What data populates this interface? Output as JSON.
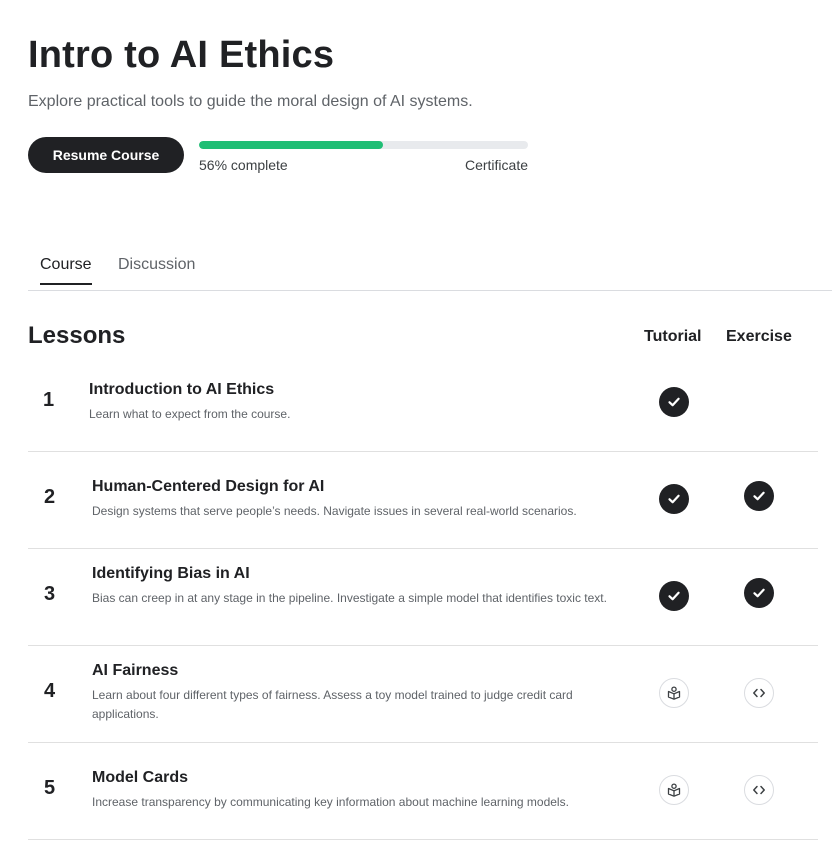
{
  "course": {
    "title": "Intro to AI Ethics",
    "subtitle": "Explore practical tools to guide the moral design of AI systems.",
    "resume_label": "Resume Course",
    "progress_percent": 56,
    "progress_text": "56% complete",
    "certificate_label": "Certificate"
  },
  "colors": {
    "progress": "#20be75",
    "primary": "#202124"
  },
  "tabs": [
    {
      "label": "Course",
      "active": true
    },
    {
      "label": "Discussion",
      "active": false
    }
  ],
  "lessons_section": {
    "heading": "Lessons",
    "tutorial_header": "Tutorial",
    "exercise_header": "Exercise"
  },
  "lessons": [
    {
      "number": "1",
      "title": "Introduction to AI Ethics",
      "description": "Learn what to expect from the course.",
      "tutorial": "completed-check-icon",
      "exercise": null
    },
    {
      "number": "2",
      "title": "Human-Centered Design for AI",
      "description": "Design systems that serve people’s needs. Navigate issues in several real-world scenarios.",
      "tutorial": "completed-check-icon",
      "exercise": "completed-check-icon"
    },
    {
      "number": "3",
      "title": "Identifying Bias in AI",
      "description": "Bias can creep in at any stage in the pipeline. Investigate a simple model that identifies toxic text.",
      "tutorial": "completed-check-icon",
      "exercise": "completed-check-icon"
    },
    {
      "number": "4",
      "title": "AI Fairness",
      "description": "Learn about four different types of fairness. Assess a toy model trained to judge credit card applications.",
      "tutorial": "book-icon",
      "exercise": "code-icon"
    },
    {
      "number": "5",
      "title": "Model Cards",
      "description": "Increase transparency by communicating key information about machine learning models.",
      "tutorial": "book-icon",
      "exercise": "code-icon"
    }
  ]
}
